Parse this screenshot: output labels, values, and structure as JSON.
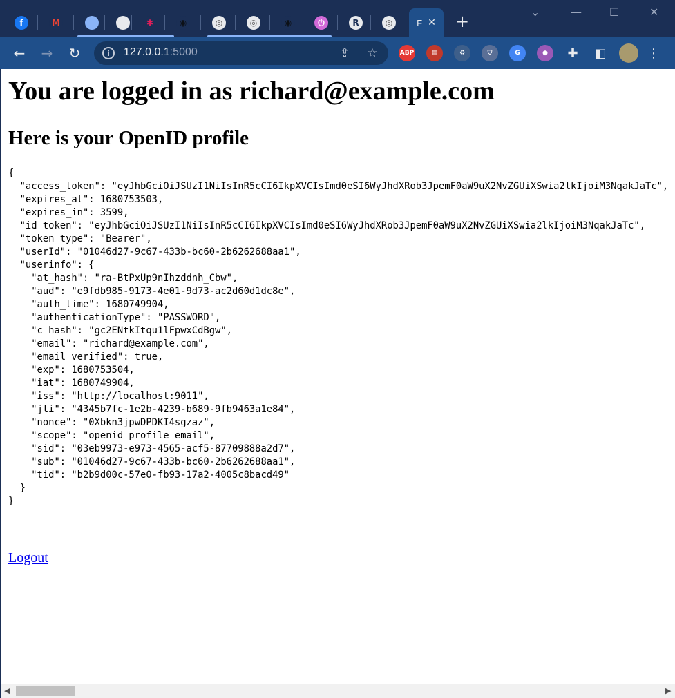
{
  "browser": {
    "tabs": [
      {
        "name": "facebook",
        "glyph": "f",
        "color": "#1877f2",
        "fg": "#ffffff"
      },
      {
        "name": "gmail",
        "glyph": "M",
        "color": "#1b2f55",
        "fg": "#ea4335"
      },
      {
        "name": "blue-circle",
        "glyph": "",
        "color": "#8ab4f8",
        "fg": "#ffffff"
      },
      {
        "name": "white-circle",
        "glyph": "",
        "color": "#e8eaed",
        "fg": "#ffffff"
      },
      {
        "name": "slack",
        "glyph": "✱",
        "color": "#1b2f55",
        "fg": "#e01e5a"
      },
      {
        "name": "github",
        "glyph": "◉",
        "color": "#1b2f55",
        "fg": "#0d1117"
      },
      {
        "name": "app-ring-1",
        "glyph": "◎",
        "color": "#e8eaed",
        "fg": "#555555"
      },
      {
        "name": "app-ring-2",
        "glyph": "◎",
        "color": "#e8eaed",
        "fg": "#555555"
      },
      {
        "name": "github-2",
        "glyph": "◉",
        "color": "#1b2f55",
        "fg": "#0d1117"
      },
      {
        "name": "power",
        "glyph": "⏻",
        "color": "#d26ad8",
        "fg": "#ffffff"
      },
      {
        "name": "r-app",
        "glyph": "R",
        "color": "#e8eaed",
        "fg": "#1b2f55"
      },
      {
        "name": "app-ring-3",
        "glyph": "◎",
        "color": "#e8eaed",
        "fg": "#555555"
      }
    ],
    "active_tab_letter": "F",
    "url_host": "127.0.0.1",
    "url_port": ":5000",
    "extensions": [
      {
        "name": "adblock-plus",
        "label": "ABP",
        "color": "#e53935"
      },
      {
        "name": "reader",
        "label": "▤",
        "color": "#c0392b"
      },
      {
        "name": "recycle",
        "label": "♻",
        "color": "#3e5f8a"
      },
      {
        "name": "shield",
        "label": "⛉",
        "color": "#5a6f96"
      },
      {
        "name": "translate",
        "label": "G",
        "color": "#4285f4"
      },
      {
        "name": "drop",
        "label": "●",
        "color": "#9b59b6"
      }
    ]
  },
  "page": {
    "heading": "You are logged in as richard@example.com",
    "subheading": "Here is your OpenID profile",
    "profile_json": "{\n  \"access_token\": \"eyJhbGciOiJSUzI1NiIsInR5cCI6IkpXVCIsImd0eSI6WyJhdXRob3JpemF0aW9uX2NvZGUiXSwia2lkIjoiM3NqakJaTc\",\n  \"expires_at\": 1680753503,\n  \"expires_in\": 3599,\n  \"id_token\": \"eyJhbGciOiJSUzI1NiIsInR5cCI6IkpXVCIsImd0eSI6WyJhdXRob3JpemF0aW9uX2NvZGUiXSwia2lkIjoiM3NqakJaTc\",\n  \"token_type\": \"Bearer\",\n  \"userId\": \"01046d27-9c67-433b-bc60-2b6262688aa1\",\n  \"userinfo\": {\n    \"at_hash\": \"ra-BtPxUp9nIhzddnh_Cbw\",\n    \"aud\": \"e9fdb985-9173-4e01-9d73-ac2d60d1dc8e\",\n    \"auth_time\": 1680749904,\n    \"authenticationType\": \"PASSWORD\",\n    \"c_hash\": \"gc2ENtkItqu1lFpwxCdBgw\",\n    \"email\": \"richard@example.com\",\n    \"email_verified\": true,\n    \"exp\": 1680753504,\n    \"iat\": 1680749904,\n    \"iss\": \"http://localhost:9011\",\n    \"jti\": \"4345b7fc-1e2b-4239-b689-9fb9463a1e84\",\n    \"nonce\": \"0Xbkn3jpwDPDKI4sgzaz\",\n    \"scope\": \"openid profile email\",\n    \"sid\": \"03eb9973-e973-4565-acf5-87709888a2d7\",\n    \"sub\": \"01046d27-9c67-433b-bc60-2b6262688aa1\",\n    \"tid\": \"b2b9d00c-57e0-fb93-17a2-4005c8bacd49\"\n  }\n}",
    "logout_label": "Logout"
  }
}
